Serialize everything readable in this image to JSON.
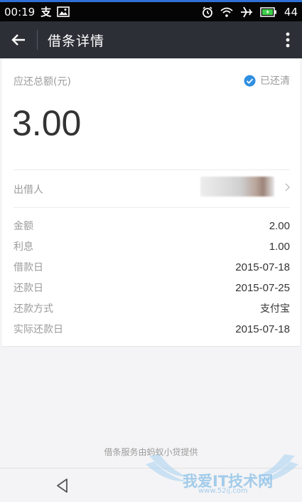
{
  "status_bar": {
    "time": "00:19",
    "notification_char": "支",
    "battery": "44"
  },
  "app_bar": {
    "title": "借条详情"
  },
  "summary": {
    "amount_label": "应还总额(元)",
    "status_text": "已还清",
    "amount": "3.00"
  },
  "lender": {
    "label": "出借人"
  },
  "details": [
    {
      "label": "金额",
      "value": "2.00"
    },
    {
      "label": "利息",
      "value": "1.00"
    },
    {
      "label": "借款日",
      "value": "2015-07-18"
    },
    {
      "label": "还款日",
      "value": "2015-07-25"
    },
    {
      "label": "还款方式",
      "value": "支付宝"
    },
    {
      "label": "实际还款日",
      "value": "2015-07-18"
    }
  ],
  "footer": {
    "note": "借条服务由蚂蚁小贷提供"
  },
  "watermark": {
    "text": "我爱IT技术网",
    "url": "www.52ij.com"
  },
  "colors": {
    "app_bar": "#2c2f36",
    "accent_check": "#2f8fe0",
    "status_bar": "#050505"
  }
}
